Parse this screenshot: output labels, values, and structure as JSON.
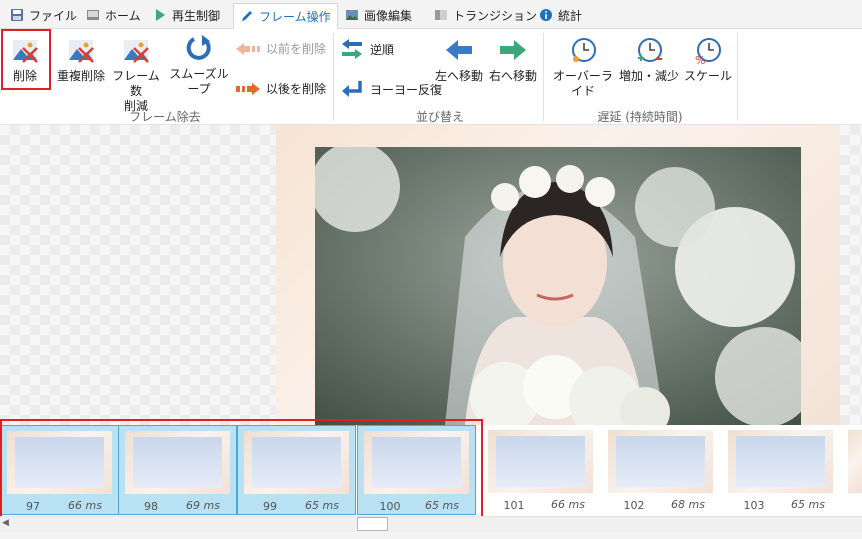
{
  "tabs": [
    {
      "label": "ファイル",
      "icon": "save-icon"
    },
    {
      "label": "ホーム",
      "icon": "home-icon"
    },
    {
      "label": "再生制御",
      "icon": "play-icon"
    },
    {
      "label": "フレーム操作",
      "icon": "pencil-icon",
      "active": true
    },
    {
      "label": "画像編集",
      "icon": "image-icon"
    },
    {
      "label": "トランジション",
      "icon": "transition-icon"
    },
    {
      "label": "統計",
      "icon": "info-icon"
    }
  ],
  "ribbon": {
    "groups": {
      "frame_remove": "フレーム除去",
      "reorder": "並び替え",
      "delay": "遅延 (持続時間)"
    },
    "buttons": {
      "delete": "削除",
      "dedupe": "重複削除",
      "reduce_line1": "フレーム数",
      "reduce_line2": "削減",
      "smooth_loop": "スムーズループ",
      "delete_before": "以前を削除",
      "delete_after": "以後を削除",
      "reverse": "逆順",
      "yoyo": "ヨーヨー反復",
      "move_left": "左へ移動",
      "move_right": "右へ移動",
      "override": "オーバーライド",
      "increase_decrease": "増加・減少",
      "scale": "スケール"
    }
  },
  "frames": [
    {
      "num": "97",
      "ms": "66 ms",
      "selected": true
    },
    {
      "num": "98",
      "ms": "69 ms",
      "selected": true
    },
    {
      "num": "99",
      "ms": "65 ms",
      "selected": true
    },
    {
      "num": "100",
      "ms": "65 ms",
      "selected": true
    },
    {
      "num": "101",
      "ms": "66 ms",
      "selected": false
    },
    {
      "num": "102",
      "ms": "68 ms",
      "selected": false
    },
    {
      "num": "103",
      "ms": "65 ms",
      "selected": false
    }
  ],
  "colors": {
    "accent": "#1e6fc2",
    "highlight": "#e02020",
    "selection": "#b9e1f4",
    "arrow_blue": "#3a7bc8",
    "arrow_green": "#3aa87a",
    "arrow_orange": "#e36a2e"
  }
}
